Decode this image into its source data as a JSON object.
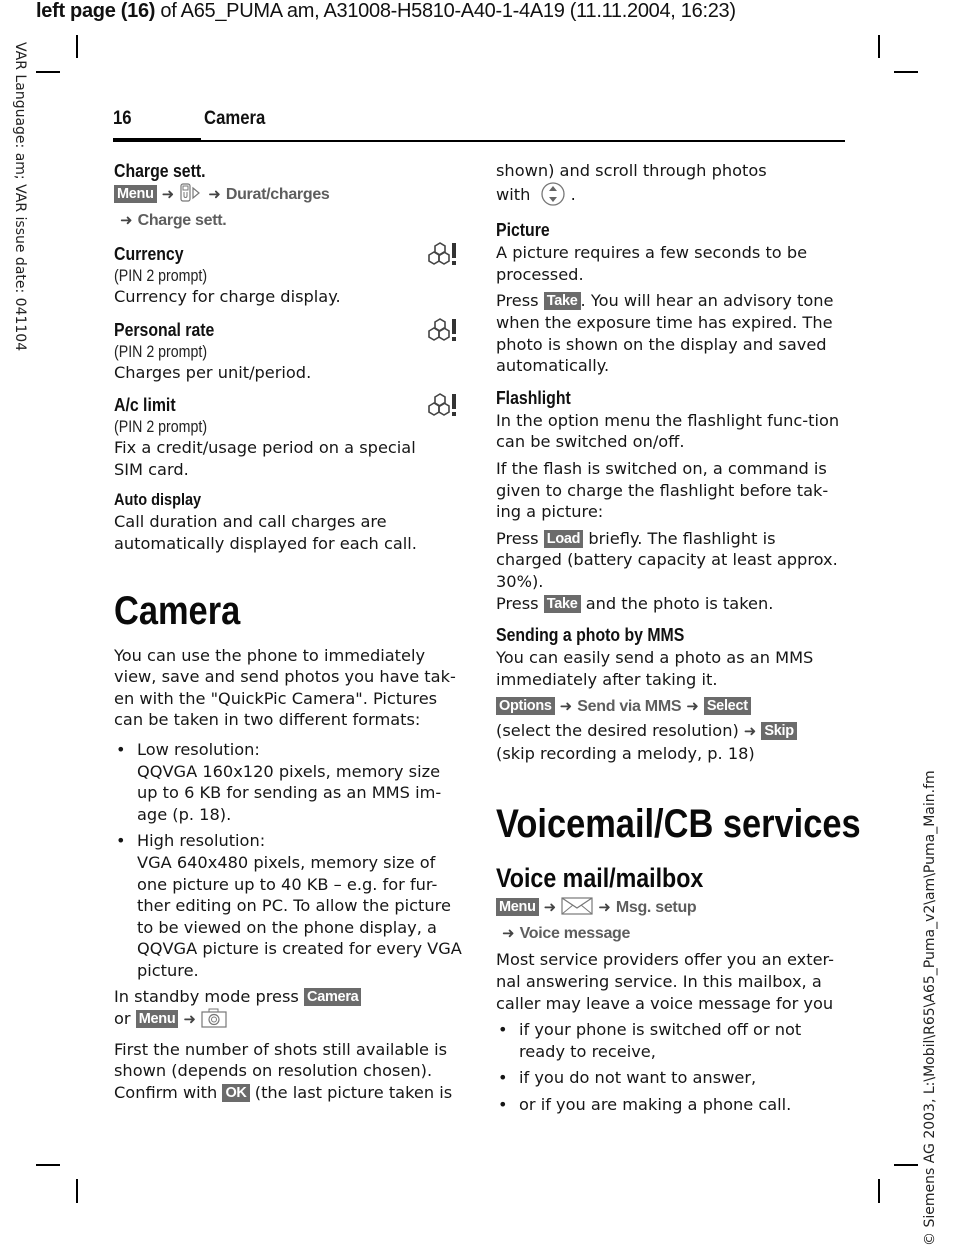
{
  "print_header": {
    "bold_part": "left page (16)",
    "rest": " of A65_PUMA am, A31008-H5810-A40-1-4A19 (11.11.2004, 16:23)"
  },
  "side_left": "VAR Language: am; VAR issue date: 041104",
  "side_right": "© Siemens AG 2003, L:\\Mobil\\R65\\A65_Puma_v2\\am\\Puma_Main.fm",
  "running_header": {
    "page_number": "16",
    "title": "Camera"
  },
  "left_column": {
    "charge_sett": {
      "title": "Charge sett.",
      "path": [
        {
          "type": "key",
          "label": "Menu"
        },
        {
          "type": "icon",
          "icon": "phone-settings-icon"
        },
        {
          "type": "nav",
          "label": "Durat/charges"
        },
        {
          "type": "nav",
          "label": "Charge sett."
        }
      ]
    },
    "settings": [
      {
        "title": "Currency",
        "note": "(PIN 2 prompt)",
        "text": "Currency for charge display.",
        "icon": "network-pin-warning-icon"
      },
      {
        "title": "Personal rate",
        "note": "(PIN 2 prompt)",
        "text": "Charges per unit/period.",
        "icon": "network-pin-warning-icon"
      },
      {
        "title": "A/c limit",
        "note": "(PIN 2 prompt)",
        "text": "Fix a credit/usage period on a special SIM card.",
        "icon": "network-pin-warning-icon"
      }
    ],
    "auto_display": {
      "title": "Auto display",
      "text": "Call duration and call charges are automatically displayed for each call."
    },
    "camera": {
      "heading": "Camera",
      "intro": "You can use the phone to immediately view, save and send photos you have tak-en with the \"QuickPic Camera\". Pictures can be taken in two different formats:",
      "bullets": [
        {
          "label": "Low resolution:",
          "text": "QQVGA 160x120 pixels, memory size up to 6 KB for sending as an MMS im-age (p. 18)."
        },
        {
          "label": "High resolution:",
          "text": "VGA 640x480 pixels, memory size of one picture up to 40 KB – e.g. for fur-ther editing on PC. To allow the picture to be viewed on the phone display, a QQVGA picture is created for every VGA picture."
        }
      ],
      "standby_prefix": "In standby mode press",
      "standby_key": "Camera",
      "standby_or": "or",
      "standby_menu_key": "Menu",
      "standby_icon": "camera-icon",
      "shots_text": "First the number of shots still available is shown (depends on resolution chosen).",
      "confirm_prefix": "Confirm with",
      "confirm_key": "OK",
      "confirm_suffix": "(the last picture taken is"
    }
  },
  "right_column": {
    "continued": "shown) and scroll through photos",
    "with_label": "with",
    "scroll_icon": "navigation-key-up-down-icon",
    "picture": {
      "title": "Picture",
      "p1": "A picture requires a few seconds to be processed.",
      "p2_prefix": "Press",
      "p2_key": "Take",
      "p2_suffix": ". You will hear an advisory tone when the exposure time has expired. The photo is shown on the display and saved automatically."
    },
    "flashlight": {
      "title": "Flashlight",
      "p1": "In the option menu the flashlight func-tion can be switched on/off.",
      "p2": "If the flash is switched on, a command is given to charge the flashlight before tak-ing a picture:",
      "p3_prefix": "Press",
      "p3_key": "Load",
      "p3_suffix": "briefly. The flashlight is charged (battery capacity at least approx. 30%).",
      "p4_prefix": "Press",
      "p4_key": "Take",
      "p4_suffix": "and the photo is taken."
    },
    "mms": {
      "title": "Sending a photo by MMS",
      "p1": "You can easily send a photo as an MMS immediately after taking it.",
      "key_options": "Options",
      "nav_send": "Send via MMS",
      "key_select": "Select",
      "select_text": "(select the desired resolution)",
      "key_skip": "Skip",
      "skip_text": "(skip recording a melody, p. 18)"
    },
    "voicemail": {
      "heading": "Voicemail/CB services",
      "subheading": "Voice mail/mailbox",
      "path_key": "Menu",
      "path_icon": "envelope-icon",
      "path_nav1": "Msg. setup",
      "path_nav2": "Voice message",
      "intro": "Most service providers offer you an exter-nal answering service. In this mailbox, a caller may leave a voice message for you",
      "bullets": [
        "if your phone is switched off or not ready to receive,",
        "if you do not want to answer,",
        "or if you are making a phone call."
      ]
    }
  }
}
